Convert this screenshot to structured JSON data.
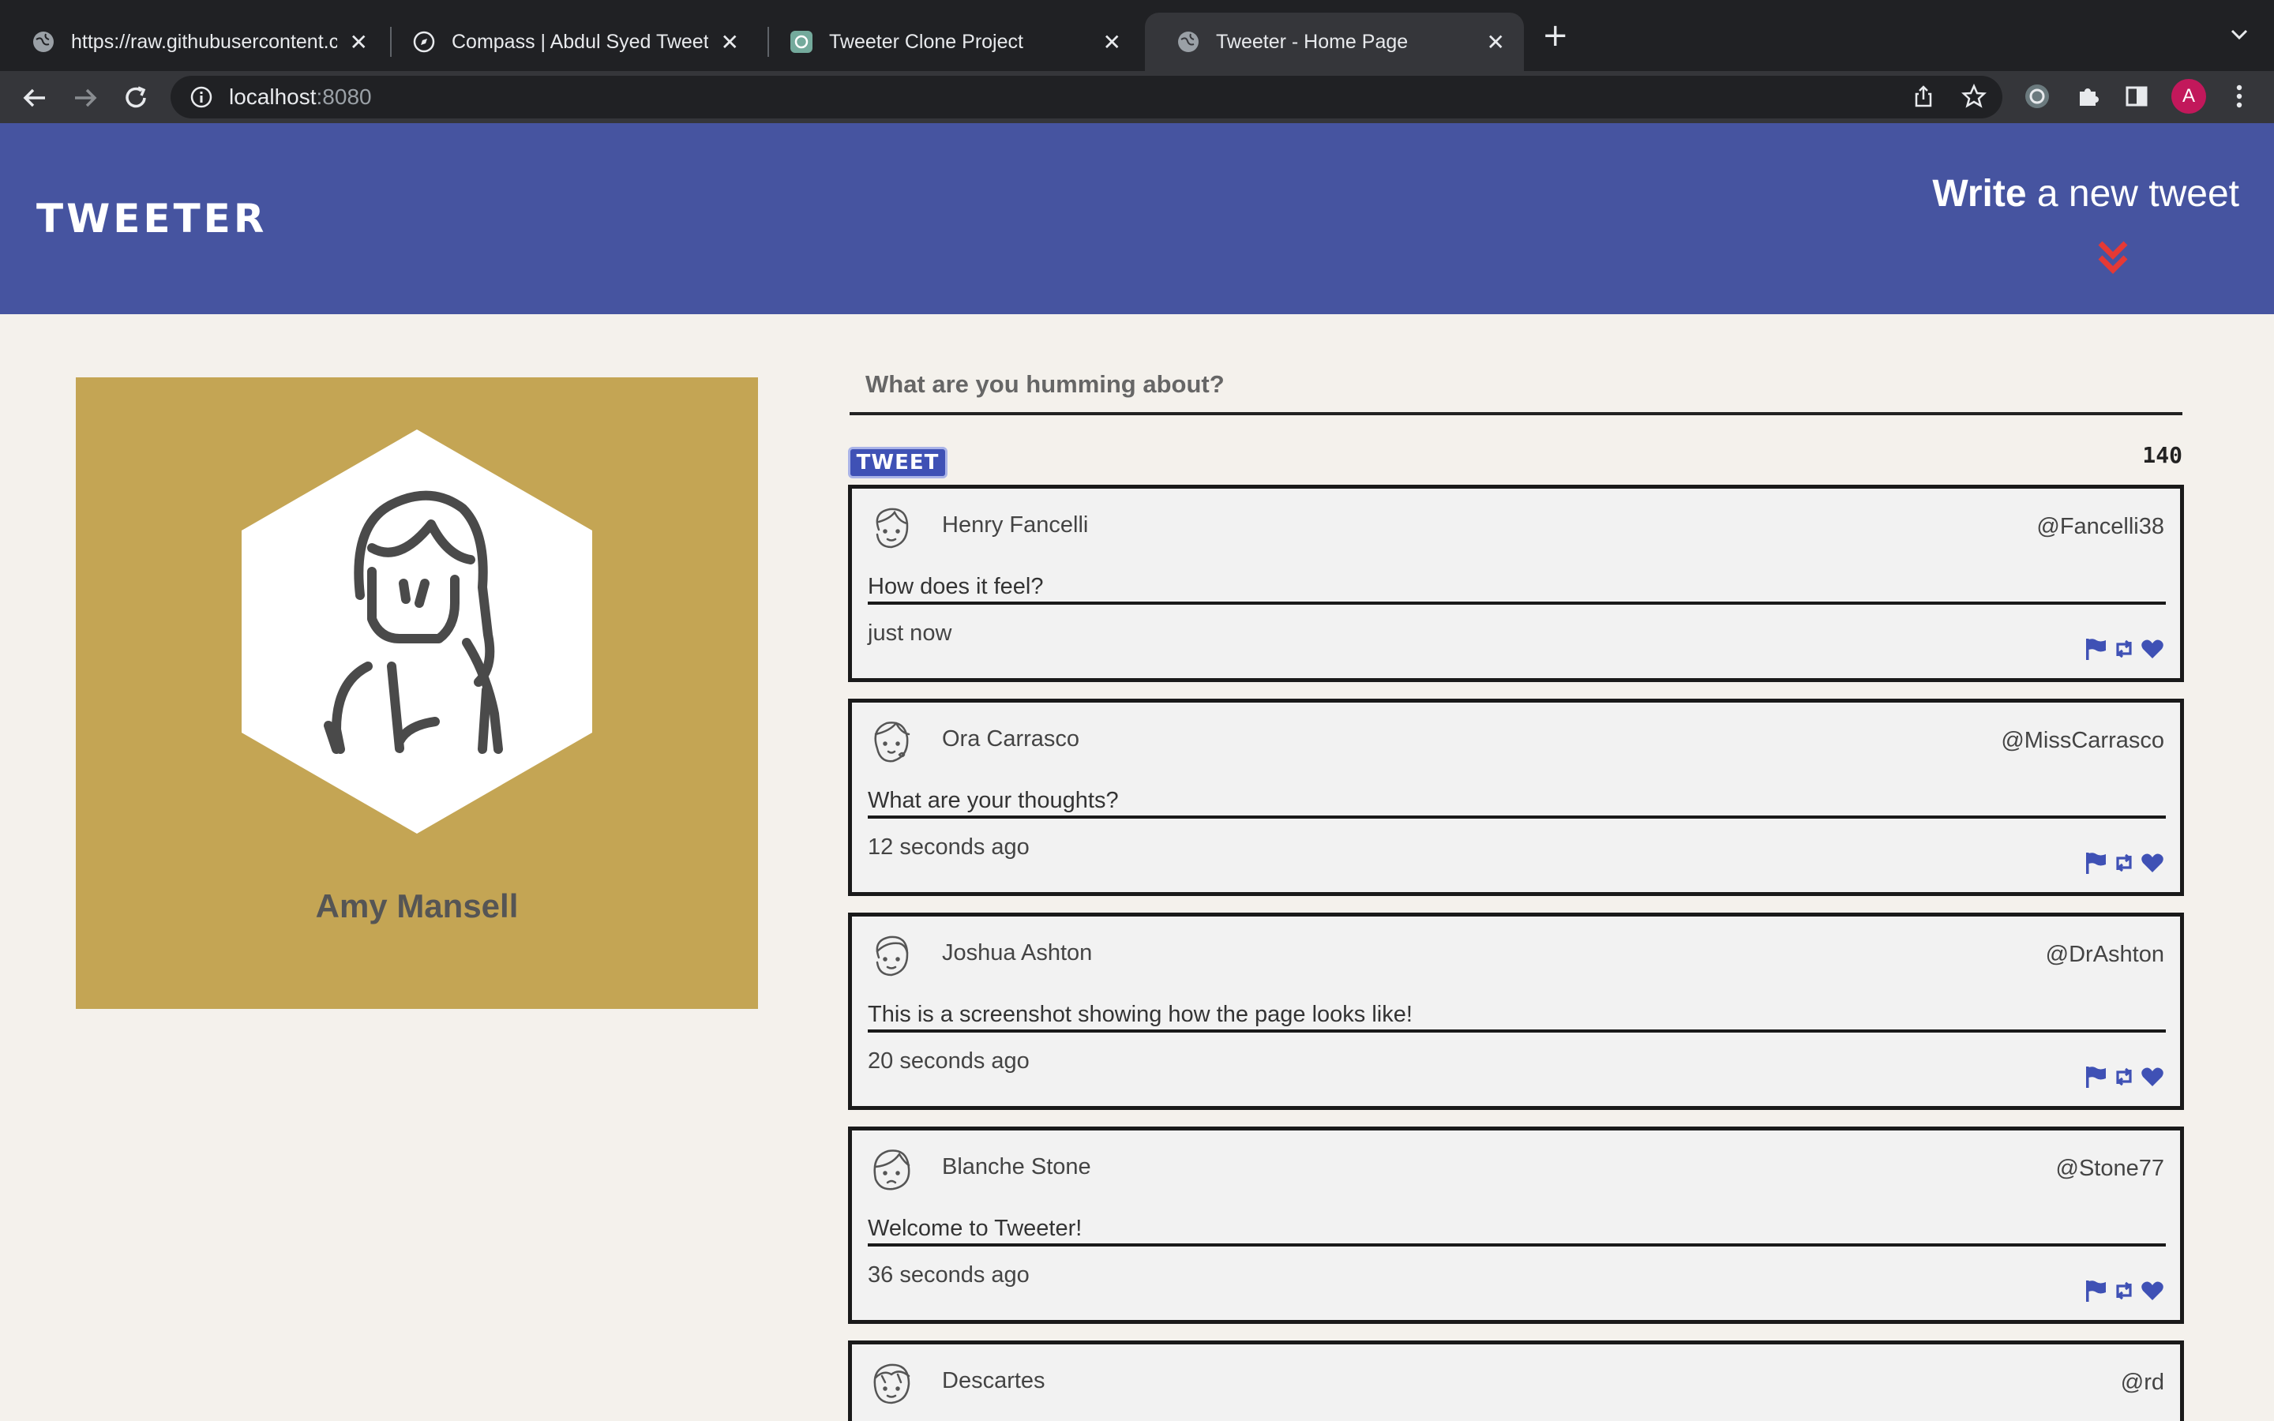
{
  "browser": {
    "tabs": [
      {
        "title": "https://raw.githubusercontent.com",
        "active": false
      },
      {
        "title": "Compass | Abdul Syed Tweeter",
        "active": false
      },
      {
        "title": "Tweeter Clone Project",
        "active": false
      },
      {
        "title": "Tweeter - Home Page",
        "active": true
      }
    ],
    "url": {
      "host": "localhost",
      "port": ":8080"
    },
    "profile_initial": "A"
  },
  "header": {
    "logo": "TWEETER",
    "compose_bold": "Write",
    "compose_rest": " a new tweet"
  },
  "profile": {
    "name": "Amy Mansell"
  },
  "composer": {
    "placeholder": "What are you humming about?",
    "button": "TWEET",
    "counter": "140"
  },
  "tweets": [
    {
      "name": "Henry Fancelli",
      "handle": "@Fancelli38",
      "text": "How does it feel?",
      "time": "just now"
    },
    {
      "name": "Ora Carrasco",
      "handle": "@MissCarrasco",
      "text": "What are your thoughts?",
      "time": "12 seconds ago"
    },
    {
      "name": "Joshua Ashton",
      "handle": "@DrAshton",
      "text": "This is a screenshot showing how the page looks like!",
      "time": "20 seconds ago"
    },
    {
      "name": "Blanche Stone",
      "handle": "@Stone77",
      "text": "Welcome to Tweeter!",
      "time": "36 seconds ago"
    },
    {
      "name": "Descartes",
      "handle": "@rd",
      "text": "",
      "time": ""
    }
  ],
  "colors": {
    "header_bg": "#4654a0",
    "accent": "#3f51b5",
    "chevron": "#e53935",
    "profile_bg": "#c4a554",
    "page_bg": "#f4f1ec"
  }
}
